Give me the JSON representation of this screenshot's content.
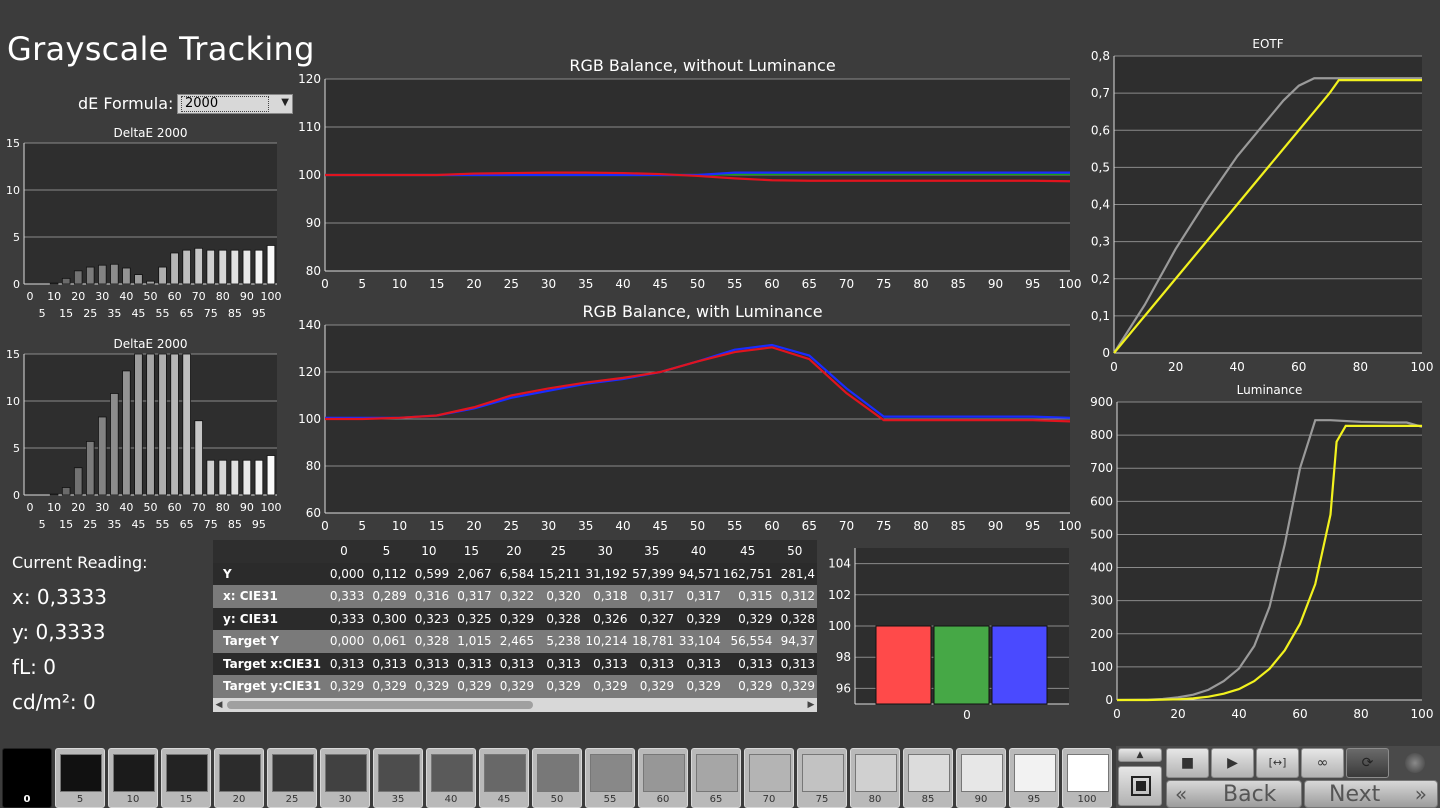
{
  "page": {
    "title": "Grayscale Tracking"
  },
  "de_formula": {
    "label": "dE Formula:",
    "value": "2000"
  },
  "colors": {
    "red": "#e0141e",
    "green": "#18a018",
    "blue": "#1a2cff",
    "yellow": "#f2f21e",
    "gray": "#9a9a9a",
    "plot_bg": "#2e2e2e"
  },
  "chart_data": [
    {
      "type": "bar",
      "title": "DeltaE 2000",
      "categories": [
        "0",
        "5",
        "10",
        "15",
        "20",
        "25",
        "30",
        "35",
        "40",
        "45",
        "50",
        "55",
        "60",
        "65",
        "70",
        "75",
        "80",
        "85",
        "90",
        "95",
        "100"
      ],
      "values": [
        0,
        0,
        0.1,
        0.6,
        1.4,
        1.8,
        2.0,
        2.1,
        1.7,
        1.0,
        0.3,
        1.8,
        3.3,
        3.6,
        3.8,
        3.6,
        3.6,
        3.6,
        3.6,
        3.6,
        4.1
      ],
      "ylim": [
        0,
        15
      ],
      "yticks": [
        "0",
        "5",
        "10",
        "15"
      ],
      "xticks_top": [
        "0",
        "10",
        "20",
        "30",
        "40",
        "50",
        "60",
        "70",
        "80",
        "90",
        "100"
      ],
      "xticks_bottom": [
        "5",
        "15",
        "25",
        "35",
        "45",
        "55",
        "65",
        "75",
        "85",
        "95"
      ],
      "grid": true
    },
    {
      "type": "bar",
      "title": "DeltaE 2000",
      "categories": [
        "0",
        "5",
        "10",
        "15",
        "20",
        "25",
        "30",
        "35",
        "40",
        "45",
        "50",
        "55",
        "60",
        "65",
        "70",
        "75",
        "80",
        "85",
        "90",
        "95",
        "100"
      ],
      "values": [
        0,
        0,
        0.1,
        0.8,
        2.9,
        5.7,
        8.3,
        10.8,
        13.2,
        15,
        15,
        15,
        15,
        15,
        7.9,
        3.7,
        3.7,
        3.7,
        3.7,
        3.7,
        4.2
      ],
      "ylim": [
        0,
        15
      ],
      "yticks": [
        "0",
        "5",
        "10",
        "15"
      ],
      "xticks_top": [
        "0",
        "10",
        "20",
        "30",
        "40",
        "50",
        "60",
        "70",
        "80",
        "90",
        "100"
      ],
      "xticks_bottom": [
        "5",
        "15",
        "25",
        "35",
        "45",
        "55",
        "65",
        "75",
        "85",
        "95"
      ],
      "grid": true
    },
    {
      "type": "line",
      "title": "RGB Balance, without Luminance",
      "x": [
        0,
        5,
        10,
        15,
        20,
        25,
        30,
        35,
        40,
        45,
        50,
        55,
        60,
        65,
        70,
        75,
        80,
        85,
        90,
        95,
        100
      ],
      "series": [
        {
          "color": "green",
          "values": [
            100,
            100,
            100,
            100,
            100,
            100,
            100,
            100,
            100,
            100,
            100,
            100.2,
            100.2,
            100.2,
            100.2,
            100.2,
            100.2,
            100.2,
            100.2,
            100.2,
            100.2
          ]
        },
        {
          "color": "blue",
          "values": [
            100,
            100,
            100,
            100,
            100,
            100,
            100,
            100,
            100,
            100,
            100,
            100.5,
            100.5,
            100.5,
            100.5,
            100.5,
            100.5,
            100.5,
            100.5,
            100.5,
            100.5
          ]
        },
        {
          "color": "red",
          "values": [
            100,
            100,
            100,
            100,
            100.3,
            100.4,
            100.5,
            100.5,
            100.4,
            100.2,
            99.8,
            99.3,
            98.9,
            98.8,
            98.8,
            98.8,
            98.8,
            98.8,
            98.8,
            98.8,
            98.7
          ]
        }
      ],
      "ylim": [
        80,
        120
      ],
      "yticks": [
        "80",
        "90",
        "100",
        "110",
        "120"
      ],
      "xticks": [
        "0",
        "5",
        "10",
        "15",
        "20",
        "25",
        "30",
        "35",
        "40",
        "45",
        "50",
        "55",
        "60",
        "65",
        "70",
        "75",
        "80",
        "85",
        "90",
        "95",
        "100"
      ],
      "grid": true
    },
    {
      "type": "line",
      "title": "RGB Balance, with Luminance",
      "x": [
        0,
        5,
        10,
        15,
        20,
        25,
        30,
        35,
        40,
        45,
        50,
        55,
        60,
        65,
        70,
        75,
        80,
        85,
        90,
        95,
        100
      ],
      "series": [
        {
          "color": "blue",
          "values": [
            100.5,
            100.5,
            100.5,
            101.5,
            104.5,
            109,
            112,
            115,
            117,
            120,
            124.5,
            129.5,
            131.5,
            127,
            113,
            101,
            101,
            101,
            101,
            101,
            100.5
          ]
        },
        {
          "color": "red",
          "values": [
            100,
            100,
            100.5,
            101.5,
            105,
            110,
            113,
            115.5,
            117.5,
            120,
            124.5,
            128.5,
            130.5,
            125.5,
            111,
            99.5,
            99.5,
            99.5,
            99.5,
            99.5,
            99
          ]
        }
      ],
      "ylim": [
        60,
        140
      ],
      "yticks": [
        "60",
        "80",
        "100",
        "120",
        "140"
      ],
      "xticks": [
        "0",
        "5",
        "10",
        "15",
        "20",
        "25",
        "30",
        "35",
        "40",
        "45",
        "50",
        "55",
        "60",
        "65",
        "70",
        "75",
        "80",
        "85",
        "90",
        "95",
        "100"
      ],
      "grid": true
    },
    {
      "type": "line",
      "title": "EOTF",
      "series": [
        {
          "color": "gray",
          "x": [
            0,
            10,
            20,
            30,
            40,
            50,
            55,
            60,
            65,
            70,
            80,
            90,
            100
          ],
          "values": [
            0,
            0.13,
            0.28,
            0.41,
            0.53,
            0.63,
            0.68,
            0.72,
            0.74,
            0.74,
            0.74,
            0.74,
            0.74
          ]
        },
        {
          "color": "yellow",
          "x": [
            0,
            10,
            20,
            30,
            40,
            50,
            60,
            70,
            73,
            80,
            90,
            100
          ],
          "values": [
            0,
            0.1,
            0.2,
            0.3,
            0.4,
            0.5,
            0.6,
            0.7,
            0.735,
            0.735,
            0.735,
            0.735
          ]
        }
      ],
      "ylim": [
        0,
        0.8
      ],
      "xlim": [
        0,
        100
      ],
      "yticks": [
        "0",
        "0,1",
        "0,2",
        "0,3",
        "0,4",
        "0,5",
        "0,6",
        "0,7",
        "0,8"
      ],
      "xticks": [
        "0",
        "20",
        "40",
        "60",
        "80",
        "100"
      ],
      "grid": true
    },
    {
      "type": "line",
      "title": "Luminance",
      "series": [
        {
          "color": "gray",
          "x": [
            0,
            10,
            15,
            20,
            25,
            30,
            35,
            40,
            45,
            50,
            55,
            60,
            65,
            70,
            80,
            90,
            95,
            100
          ],
          "values": [
            0,
            1,
            3,
            8,
            16,
            31,
            57,
            95,
            163,
            281,
            470,
            700,
            845,
            845,
            840,
            838,
            838,
            825
          ]
        },
        {
          "color": "yellow",
          "x": [
            0,
            10,
            20,
            25,
            30,
            35,
            40,
            45,
            50,
            55,
            60,
            65,
            70,
            72,
            75,
            80,
            90,
            100
          ],
          "values": [
            0,
            0.1,
            2,
            5,
            10,
            19,
            33,
            57,
            94,
            150,
            230,
            350,
            560,
            780,
            828,
            828,
            828,
            828
          ]
        }
      ],
      "ylim": [
        0,
        900
      ],
      "xlim": [
        0,
        100
      ],
      "yticks": [
        "0",
        "100",
        "200",
        "300",
        "400",
        "500",
        "600",
        "700",
        "800",
        "900"
      ],
      "xticks": [
        "0",
        "20",
        "40",
        "60",
        "80",
        "100"
      ],
      "grid": true
    },
    {
      "type": "bar",
      "categories": [
        "0"
      ],
      "series": [
        {
          "color": "red",
          "values": [
            100
          ]
        },
        {
          "color": "green",
          "values": [
            100
          ]
        },
        {
          "color": "blue",
          "values": [
            100
          ]
        }
      ],
      "ylim": [
        95,
        105
      ],
      "yticks": [
        "96",
        "98",
        "100",
        "102",
        "104"
      ],
      "grid": true
    }
  ],
  "reading": {
    "title": "Current Reading:",
    "x": "x: 0,3333",
    "y": "y: 0,3333",
    "fl": "fL: 0",
    "cdm2": "cd/m²: 0"
  },
  "table": {
    "columns": [
      "0",
      "5",
      "10",
      "15",
      "20",
      "25",
      "30",
      "35",
      "40",
      "45",
      "50"
    ],
    "rows": [
      {
        "label": "Y",
        "cells": [
          "0,000",
          "0,112",
          "0,599",
          "2,067",
          "6,584",
          "15,211",
          "31,192",
          "57,399",
          "94,571",
          "162,751",
          "281,4"
        ]
      },
      {
        "label": "x: CIE31",
        "cells": [
          "0,333",
          "0,289",
          "0,316",
          "0,317",
          "0,322",
          "0,320",
          "0,318",
          "0,317",
          "0,317",
          "0,315",
          "0,312"
        ]
      },
      {
        "label": "y: CIE31",
        "cells": [
          "0,333",
          "0,300",
          "0,323",
          "0,325",
          "0,329",
          "0,328",
          "0,326",
          "0,327",
          "0,329",
          "0,329",
          "0,328"
        ]
      },
      {
        "label": "Target Y",
        "cells": [
          "0,000",
          "0,061",
          "0,328",
          "1,015",
          "2,465",
          "5,238",
          "10,214",
          "18,781",
          "33,104",
          "56,554",
          "94,37"
        ]
      },
      {
        "label": "Target x:CIE31",
        "cells": [
          "0,313",
          "0,313",
          "0,313",
          "0,313",
          "0,313",
          "0,313",
          "0,313",
          "0,313",
          "0,313",
          "0,313",
          "0,313"
        ]
      },
      {
        "label": "Target y:CIE31",
        "cells": [
          "0,329",
          "0,329",
          "0,329",
          "0,329",
          "0,329",
          "0,329",
          "0,329",
          "0,329",
          "0,329",
          "0,329",
          "0,329"
        ]
      }
    ]
  },
  "swatches": {
    "labels": [
      "0",
      "5",
      "10",
      "15",
      "20",
      "25",
      "30",
      "35",
      "40",
      "45",
      "50",
      "55",
      "60",
      "65",
      "70",
      "75",
      "80",
      "85",
      "90",
      "95",
      "100"
    ],
    "colors": [
      "#000000",
      "#111111",
      "#1b1b1b",
      "#232323",
      "#2c2c2c",
      "#363636",
      "#414141",
      "#4d4d4d",
      "#5a5a5a",
      "#686868",
      "#787878",
      "#888888",
      "#979797",
      "#a6a6a6",
      "#b4b4b4",
      "#c2c2c2",
      "#d0d0d0",
      "#dcdcdc",
      "#e7e7e7",
      "#f2f2f2",
      "#ffffff"
    ],
    "selected": "0"
  },
  "nav": {
    "back": "Back",
    "next": "Next"
  }
}
